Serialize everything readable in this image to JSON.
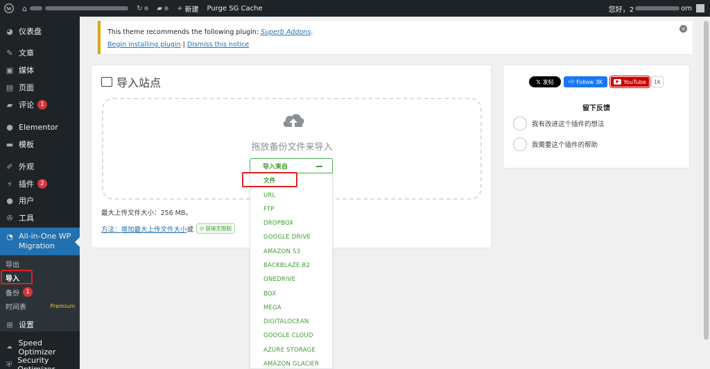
{
  "adminbar": {
    "site_menu_icon": "wp-logo-icon",
    "cache_label": "Purge SG Cache",
    "new_label": "新建",
    "greeting": "您好，2",
    "greeting_tail": "om"
  },
  "sidebar": {
    "items": [
      {
        "label": "仪表盘",
        "icon": "dashboard-icon",
        "badge": ""
      },
      {
        "label": "文章",
        "icon": "pin-icon",
        "badge": ""
      },
      {
        "label": "媒体",
        "icon": "media-icon",
        "badge": ""
      },
      {
        "label": "页面",
        "icon": "page-icon",
        "badge": ""
      },
      {
        "label": "评论",
        "icon": "comment-icon",
        "badge": "1"
      },
      {
        "label": "Elementor",
        "icon": "elementor-icon",
        "badge": ""
      },
      {
        "label": "模板",
        "icon": "folder-icon",
        "badge": ""
      },
      {
        "label": "外观",
        "icon": "brush-icon",
        "badge": ""
      },
      {
        "label": "插件",
        "icon": "plugin-icon",
        "badge": "2"
      },
      {
        "label": "用户",
        "icon": "user-icon",
        "badge": ""
      },
      {
        "label": "工具",
        "icon": "wrench-icon",
        "badge": ""
      },
      {
        "label": "All-in-One WP Migration",
        "icon": "migration-icon",
        "badge": ""
      },
      {
        "label": "设置",
        "icon": "settings-icon",
        "badge": ""
      },
      {
        "label": "Speed Optimizer",
        "icon": "speed-icon",
        "badge": ""
      },
      {
        "label": "Security Optimizer",
        "icon": "security-icon",
        "badge": ""
      }
    ],
    "submenu": {
      "export": "导出",
      "import": "导入",
      "backup": "备份",
      "backup_badge": "1",
      "schedule": "时间表",
      "premium": "Premium"
    }
  },
  "notice": {
    "text_prefix": "This theme recommends the following plugin: ",
    "plugin_link": "Superb Addons",
    "text_suffix": ".",
    "install_link": "Begin installing plugin",
    "separator": " | ",
    "dismiss_link": "Dismiss this notice",
    "close_icon": "×"
  },
  "main": {
    "title": "导入站点",
    "drop_text": "拖放备份文件来导入",
    "import_from": "导入来自",
    "options": [
      "文件",
      "URL",
      "FTP",
      "DROPBOX",
      "GOOGLE DRIVE",
      "AMAZON S3",
      "BACKBLAZE B2",
      "ONEDRIVE",
      "BOX",
      "MEGA",
      "DIGITALOCEAN",
      "GOOGLE CLOUD",
      "AZURE STORAGE",
      "AMAZON GLACIER"
    ],
    "max_size": "最大上传文件大小：256 MB。",
    "how_link": "方法：增加最大上传文件大小",
    "or": " 或 ",
    "unlimited": "获得无限制"
  },
  "side": {
    "x_label": "发帖",
    "fb_label": "Follow 3K",
    "yt_label": "YouTube",
    "yt_count": "1K",
    "feedback_title": "留下反馈",
    "option1": "我有改进这个插件的想法",
    "option2": "我需要这个插件的帮助"
  }
}
